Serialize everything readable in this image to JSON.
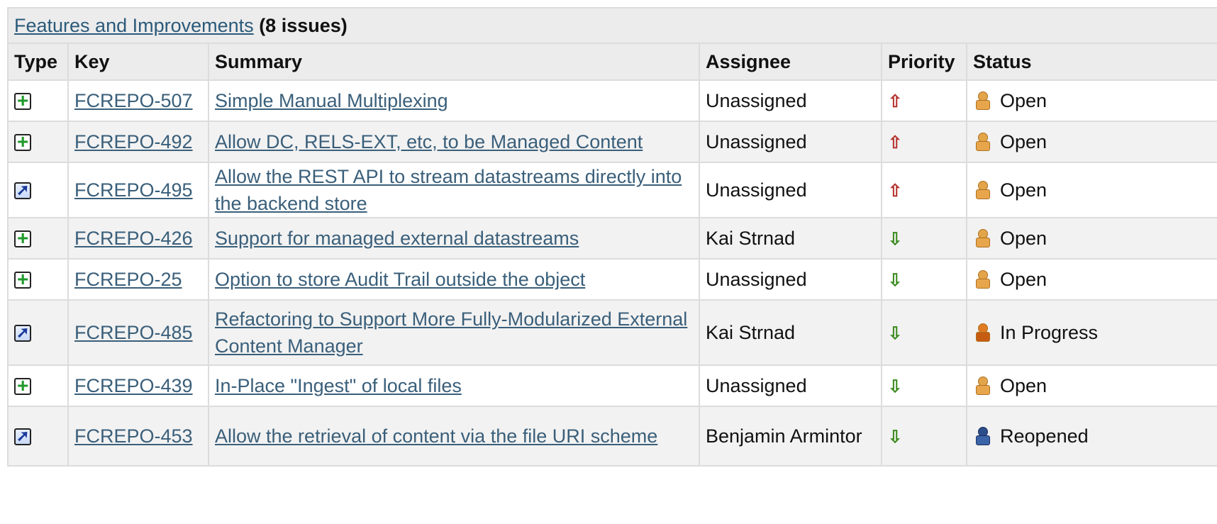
{
  "section": {
    "title_link": "Features and Improvements",
    "title_count": "(8 issues)"
  },
  "columns": {
    "type": "Type",
    "key": "Key",
    "summary": "Summary",
    "assignee": "Assignee",
    "priority": "Priority",
    "status": "Status"
  },
  "rows": [
    {
      "type": "new-feature-icon",
      "key": "FCREPO-507",
      "summary": "Simple Manual Multiplexing",
      "assignee": "Unassigned",
      "priority": "up-arrow-icon",
      "status_icon": "open-icon",
      "status": "Open"
    },
    {
      "type": "new-feature-icon",
      "key": "FCREPO-492",
      "summary": "Allow DC, RELS-EXT, etc, to be Managed Content",
      "assignee": "Unassigned",
      "priority": "up-arrow-icon",
      "status_icon": "open-icon",
      "status": "Open"
    },
    {
      "type": "improvement-icon",
      "key": "FCREPO-495",
      "summary": "Allow the REST API to stream datastreams directly into the backend store",
      "assignee": "Unassigned",
      "priority": "up-arrow-icon",
      "status_icon": "open-icon",
      "status": "Open"
    },
    {
      "type": "new-feature-icon",
      "key": "FCREPO-426",
      "summary": "Support for managed external datastreams",
      "assignee": "Kai Strnad",
      "priority": "down-arrow-icon",
      "status_icon": "open-icon",
      "status": "Open"
    },
    {
      "type": "new-feature-icon",
      "key": "FCREPO-25",
      "summary": "Option to store Audit Trail outside the object",
      "assignee": "Unassigned",
      "priority": "down-arrow-icon",
      "status_icon": "open-icon",
      "status": "Open"
    },
    {
      "type": "improvement-icon",
      "key": "FCREPO-485",
      "summary": "Refactoring to Support More Fully-Modularized External Content Manager",
      "assignee": "Kai Strnad",
      "priority": "down-arrow-icon",
      "status_icon": "in-progress-icon",
      "status": "In Progress"
    },
    {
      "type": "new-feature-icon",
      "key": "FCREPO-439",
      "summary": "In-Place \"Ingest\" of local files",
      "assignee": "Unassigned",
      "priority": "down-arrow-icon",
      "status_icon": "open-icon",
      "status": "Open"
    },
    {
      "type": "improvement-icon",
      "key": "FCREPO-453",
      "summary": "Allow the retrieval of content via the file URI scheme",
      "assignee": "Benjamin Armintor",
      "priority": "down-arrow-icon",
      "status_icon": "reopened-icon",
      "status": "Reopened"
    }
  ],
  "colors": {
    "link": "#3a5f7a",
    "header_bg": "#ececec",
    "priority_up": "#b5332e",
    "priority_down": "#3a8a1e"
  }
}
